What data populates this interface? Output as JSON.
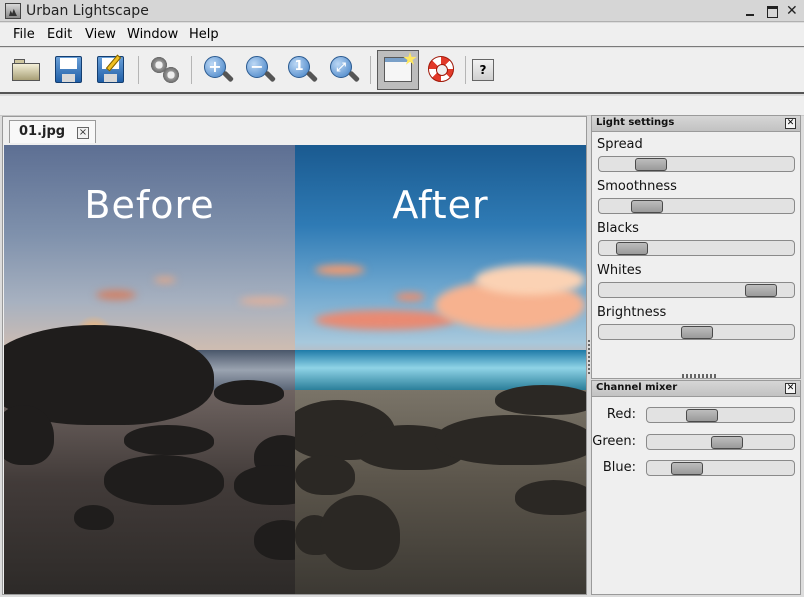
{
  "window": {
    "title": "Urban Lightscape"
  },
  "menu": [
    "File",
    "Edit",
    "View",
    "Window",
    "Help"
  ],
  "toolbar": {
    "about_label": "?"
  },
  "document": {
    "tab_label": "01.jpg",
    "before_label": "Before",
    "after_label": "After"
  },
  "light_settings": {
    "title": "Light settings",
    "sliders": [
      {
        "label": "Spread",
        "value": 0.22
      },
      {
        "label": "Smoothness",
        "value": 0.19
      },
      {
        "label": "Blacks",
        "value": 0.1
      },
      {
        "label": "Whites",
        "value": 0.9
      },
      {
        "label": "Brightness",
        "value": 0.5
      }
    ]
  },
  "channel_mixer": {
    "title": "Channel mixer",
    "sliders": [
      {
        "label": "Red:",
        "value": 0.34
      },
      {
        "label": "Green:",
        "value": 0.56
      },
      {
        "label": "Blue:",
        "value": 0.2
      }
    ]
  },
  "colors": {
    "background": "#dcdcdc",
    "panel": "#efefef",
    "slider_thumb": "#aaaaaa"
  }
}
